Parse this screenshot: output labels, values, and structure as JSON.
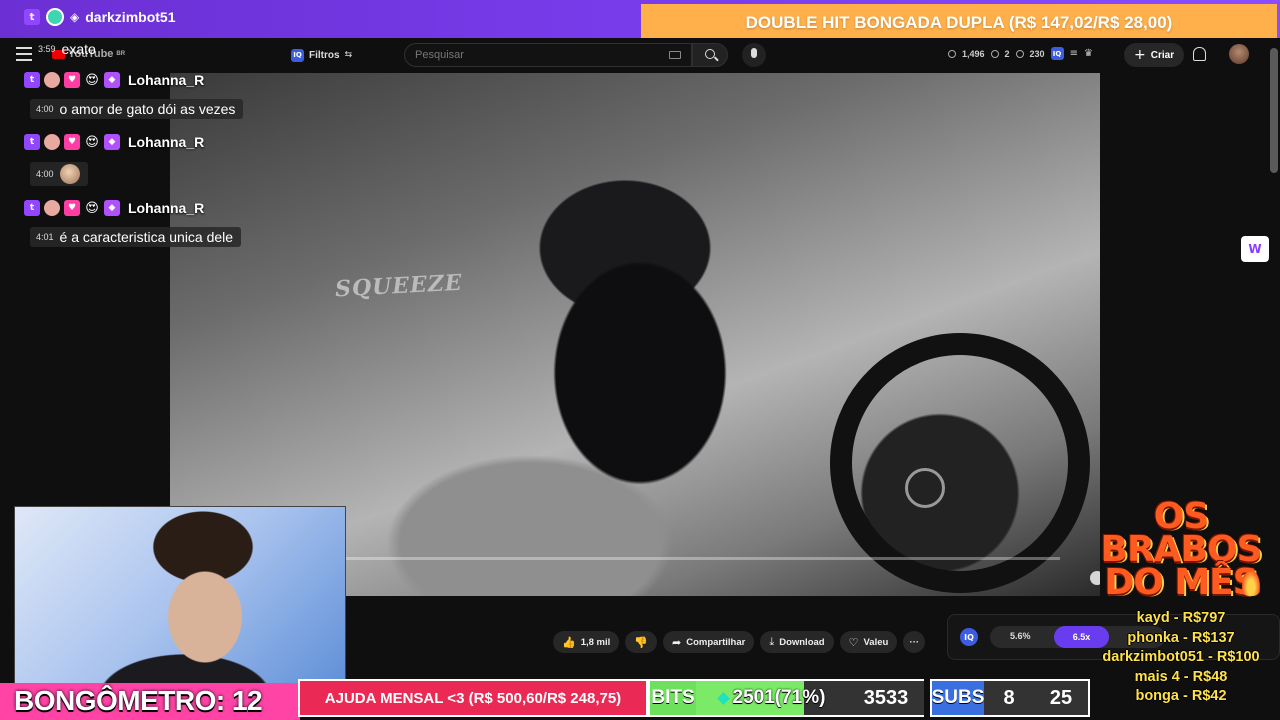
{
  "topbar": {
    "username": "darkzimbot51",
    "goal_banner": "DOUBLE HIT BONGADA DUPLA (R$ 147,02/R$ 28,00)"
  },
  "youtube": {
    "logo": "YouTube",
    "region": "BR",
    "filters_label": "Filtros",
    "search_placeholder": "Pesquisar",
    "stats": [
      "1,496",
      "2",
      "230"
    ],
    "create_label": "Criar"
  },
  "chat": {
    "pre_message": {
      "time": "3:59",
      "text": "exato"
    },
    "messages": [
      {
        "user": "Lohanna_R",
        "time": "4:00",
        "text": "o amor de gato dói as vezes"
      },
      {
        "user": "Lohanna_R",
        "time": "4:00",
        "text": ""
      },
      {
        "user": "Lohanna_R",
        "time": "4:01",
        "text": "é a caracteristica unica dele"
      }
    ]
  },
  "video": {
    "overlay_text": "SQUEEZE"
  },
  "video_actions": {
    "likes": "1,8 mil",
    "share": "Compartilhar",
    "download": "Download",
    "thanks": "Valeu"
  },
  "iq_panel": {
    "value1": "5.6%",
    "value2": "6.5x"
  },
  "bottom": {
    "bongometro": "BONGÔMETRO: 12",
    "ajuda": "AJUDA MENSAL <3 (R$ 500,60/R$ 248,75)",
    "bits_label": "BITS",
    "bits_value": "2501(71%)",
    "bits_progress": 0.71,
    "bits_goal": "3533",
    "subs_label": "SUBS",
    "subs_current": "8",
    "subs_goal": "25"
  },
  "brabos": {
    "title_line1": "OS",
    "title_line2": "BRABOS",
    "title_line3": "DO MÊS",
    "entries": [
      "kayd - R$797",
      "phonka - R$137",
      "darkzimbot051 - R$100",
      "mais 4 - R$48",
      "bonga - R$42"
    ]
  },
  "colors": {
    "topbar": "#7b3ff0",
    "goal_banner": "#ffb04a",
    "bongo": "#ff44a6",
    "ajuda": "#ea2a55",
    "bits": "#6ee15c",
    "subs": "#3a6fe0",
    "brabos_text": "#ffe14a"
  }
}
